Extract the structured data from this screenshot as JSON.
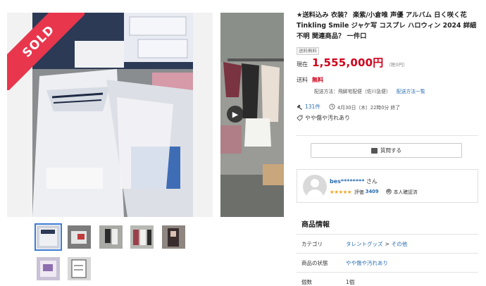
{
  "listing": {
    "title": "★送料込み 衣装？ 楽紫/小倉唯 声優 アルバム 日く咲く花 Tinkling Smile ジャケ写 コスプレ ハロウィン 2024 詳細不明 関連商品？ 一件口",
    "shipping_badge": "送料無料",
    "sold_label": "SOLD"
  },
  "price": {
    "label": "現在",
    "value": "1,555,000円",
    "tax_note": "（税0円）"
  },
  "shipping": {
    "label": "送料",
    "value": "無料",
    "method": "配送方法：飛脚宅配便（佐川急便）",
    "method_link": "配送方法一覧"
  },
  "bids": {
    "count": "131件",
    "end_time": "4月30日（木）22時0分 終了"
  },
  "condition_summary": "やや傷や汚れあり",
  "question_button": "質問する",
  "seller": {
    "id": "bes********",
    "suffix": " さん",
    "rating_label": "評価",
    "rating_value": "3409",
    "verified": "本人確認済"
  },
  "details": {
    "title": "商品情報",
    "rows": [
      {
        "key": "カテゴリ",
        "val1": "タレントグッズ",
        "sep": ">",
        "val2": "その他"
      },
      {
        "key": "商品の状態",
        "val1": "やや傷や汚れあり"
      },
      {
        "key": "個数",
        "val1": "1個"
      }
    ]
  },
  "icons": {
    "next_arrow": "chevron-right-icon",
    "hammer": "gavel-icon",
    "clock": "clock-icon",
    "condition": "tag-icon",
    "chat": "chat-icon"
  },
  "colors": {
    "sold_ribbon": "#e8364d",
    "price": "#d0021b",
    "link": "#2a6db0",
    "stars": "#f5a623"
  }
}
